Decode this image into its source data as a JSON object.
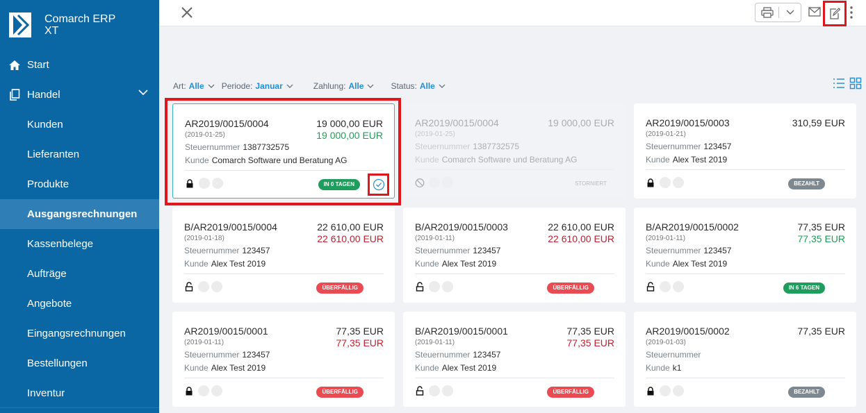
{
  "app": {
    "name_line1": "Comarch ERP",
    "name_line2": "XT"
  },
  "sidebar": {
    "top_items": [
      {
        "label": "Start"
      },
      {
        "label": "Handel"
      }
    ],
    "sub_items": [
      {
        "label": "Kunden"
      },
      {
        "label": "Lieferanten"
      },
      {
        "label": "Produkte"
      },
      {
        "label": "Ausgangsrechnungen",
        "active": true
      },
      {
        "label": "Kassenbelege"
      },
      {
        "label": "Aufträge"
      },
      {
        "label": "Angebote"
      },
      {
        "label": "Eingangsrechnungen"
      },
      {
        "label": "Bestellungen"
      },
      {
        "label": "Inventur"
      }
    ]
  },
  "filters": [
    {
      "label": "Art:",
      "value": "Alle"
    },
    {
      "label": "Periode:",
      "value": "Januar"
    },
    {
      "label": "Zahlung:",
      "value": "Alle"
    },
    {
      "label": "Status:",
      "value": "Alle"
    }
  ],
  "labels": {
    "tax": "Steuernummer",
    "customer": "Kunde"
  },
  "cards": [
    {
      "number": "AR2019/0015/0004",
      "date": "(2019-01-25)",
      "amount": "19 000,00 EUR",
      "amount2": "19 000,00 EUR",
      "amount2_color": "green",
      "tax": "1387732575",
      "customer": "Comarch Software und Beratung AG",
      "lock": "locked",
      "badge": "IN 0 TAGEN",
      "badge_color": "green",
      "selected": true
    },
    {
      "number": "AR2019/0015/0004",
      "date": "(2019-01-25)",
      "amount": "19 000,00 EUR",
      "amount2": "",
      "tax": "1387732575",
      "customer": "Comarch Software und Beratung AG",
      "lock": "cancelled",
      "status_text": "STORNIERT",
      "disabled": true
    },
    {
      "number": "AR2019/0015/0003",
      "date": "(2019-01-21)",
      "amount": "310,59 EUR",
      "amount2": "",
      "tax": "123457",
      "customer": "Alex Test 2019",
      "lock": "locked",
      "badge": "BEZAHLT",
      "badge_color": "grey"
    },
    {
      "number": "B/AR2019/0015/0004",
      "date": "(2019-01-18)",
      "amount": "22 610,00 EUR",
      "amount2": "22 610,00 EUR",
      "amount2_color": "red",
      "tax": "123457",
      "customer": "Alex Test 2019",
      "lock": "open",
      "badge": "ÜBERFÄLLIG",
      "badge_color": "red"
    },
    {
      "number": "B/AR2019/0015/0003",
      "date": "(2019-01-11)",
      "amount": "22 610,00 EUR",
      "amount2": "22 610,00 EUR",
      "amount2_color": "red",
      "tax": "123457",
      "customer": "Alex Test 2019",
      "lock": "open",
      "badge": "ÜBERFÄLLIG",
      "badge_color": "red"
    },
    {
      "number": "B/AR2019/0015/0002",
      "date": "(2019-01-11)",
      "amount": "77,35 EUR",
      "amount2": "77,35 EUR",
      "amount2_color": "green",
      "tax": "123457",
      "customer": "Alex Test 2019",
      "lock": "open",
      "badge": "IN 6 TAGEN",
      "badge_color": "green"
    },
    {
      "number": "AR2019/0015/0001",
      "date": "(2019-01-11)",
      "amount": "77,35 EUR",
      "amount2": "77,35 EUR",
      "amount2_color": "red",
      "tax": "123457",
      "customer": "Alex Test 2019",
      "lock": "locked",
      "badge": "ÜBERFÄLLIG",
      "badge_color": "red"
    },
    {
      "number": "B/AR2019/0015/0001",
      "date": "(2019-01-11)",
      "amount": "77,35 EUR",
      "amount2": "77,35 EUR",
      "amount2_color": "red",
      "tax": "123457",
      "customer": "Alex Test 2019",
      "lock": "open",
      "badge": "ÜBERFÄLLIG",
      "badge_color": "red"
    },
    {
      "number": "AR2019/0015/0002",
      "date": "(2019-01-03)",
      "amount": "77,35 EUR",
      "amount2": "",
      "tax": "",
      "customer": "k1",
      "lock": "locked",
      "badge": "BEZAHLT",
      "badge_color": "grey"
    }
  ],
  "colors": {
    "sidebar_bg": "#0a67a4",
    "sidebar_active": "#2f7fb6",
    "accent": "#1f8fd6",
    "highlight": "#e0161d"
  }
}
